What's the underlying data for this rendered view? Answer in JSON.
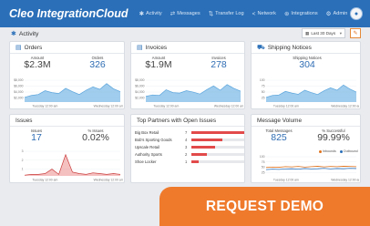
{
  "app": {
    "brand": "Cleo IntegrationCloud"
  },
  "nav": [
    {
      "label": "Activity",
      "icon": "activity-icon"
    },
    {
      "label": "Messages",
      "icon": "messages-icon"
    },
    {
      "label": "Transfer Log",
      "icon": "transfer-log-icon"
    },
    {
      "label": "Network",
      "icon": "network-icon"
    },
    {
      "label": "Integrations",
      "icon": "integrations-icon"
    },
    {
      "label": "Admin",
      "icon": "gear-icon"
    }
  ],
  "page": {
    "title": "Activity",
    "date_range": "Last 30 Days"
  },
  "orders": {
    "title": "Orders",
    "amount_label": "Amount",
    "amount": "$2.3M",
    "orders_label": "Orders",
    "orders": "326",
    "x_ticks": [
      "Tuesday 12:00 am",
      "Wednesday 12:00 am"
    ],
    "y_ticks": [
      "$8,000",
      "$6,000",
      "$4,000",
      "$2,000"
    ],
    "chart_data": {
      "type": "area",
      "x": [
        0,
        1,
        2,
        3,
        4,
        5,
        6,
        7,
        8,
        9,
        10,
        11,
        12,
        13,
        14
      ],
      "values": [
        1.0,
        1.4,
        1.6,
        2.4,
        2.0,
        1.8,
        2.9,
        2.2,
        1.6,
        2.5,
        3.2,
        2.7,
        3.9,
        2.8,
        2.2
      ],
      "ylim": [
        0,
        5
      ]
    }
  },
  "invoices": {
    "title": "Invoices",
    "amount_label": "Amount",
    "amount": "$1.9M",
    "invoices_label": "Invoices",
    "invoices": "278",
    "x_ticks": [
      "Tuesday 12:00 am",
      "Wednesday 12:00 am"
    ],
    "y_ticks": [
      "$8,000",
      "$6,000",
      "$4,000",
      "$2,000"
    ],
    "chart_data": {
      "type": "area",
      "x": [
        0,
        1,
        2,
        3,
        4,
        5,
        6,
        7,
        8,
        9,
        10,
        11,
        12,
        13,
        14
      ],
      "values": [
        1.2,
        1.5,
        1.4,
        2.6,
        2.0,
        1.9,
        2.4,
        2.1,
        1.7,
        2.6,
        3.4,
        2.5,
        3.7,
        2.9,
        2.3
      ],
      "ylim": [
        0,
        5
      ]
    }
  },
  "shipping": {
    "title": "Shipping Notices",
    "notices_label": "Shipping Notices",
    "notices": "304",
    "x_ticks": [
      "Tuesday 12:00 am",
      "Wednesday 12:00 am"
    ],
    "y_ticks": [
      "100",
      "75",
      "50",
      "25"
    ],
    "chart_data": {
      "type": "area",
      "x": [
        0,
        1,
        2,
        3,
        4,
        5,
        6,
        7,
        8,
        9,
        10,
        11,
        12,
        13,
        14
      ],
      "values": [
        20,
        28,
        30,
        45,
        38,
        33,
        50,
        40,
        32,
        48,
        60,
        50,
        72,
        55,
        42
      ],
      "ylim": [
        0,
        100
      ]
    }
  },
  "issues": {
    "title": "Issues",
    "issues_label": "Issues",
    "issues": "17",
    "pct_label": "% Issues",
    "pct": "0.02%",
    "x_ticks": [
      "Tuesday 12:00 am",
      "Wednesday 12:00 am"
    ],
    "y_ticks": [
      "3",
      "2",
      "1"
    ],
    "chart_data": {
      "type": "area",
      "x": [
        0,
        1,
        2,
        3,
        4,
        5,
        6,
        7,
        8,
        9,
        10,
        11,
        12,
        13,
        14
      ],
      "values": [
        0.1,
        0.2,
        0.2,
        0.3,
        0.9,
        0.2,
        2.8,
        0.5,
        0.3,
        0.2,
        0.4,
        0.3,
        0.2,
        0.3,
        0.2
      ],
      "ylim": [
        0,
        3.5
      ]
    }
  },
  "partners": {
    "title": "Top Partners with Open Issues",
    "rows": [
      {
        "name": "Big Box Retail",
        "count": "7",
        "fraction": 1.0
      },
      {
        "name": "Bob's Sporting Goods",
        "count": "4",
        "fraction": 0.57
      },
      {
        "name": "Upscale Retail",
        "count": "3",
        "fraction": 0.43
      },
      {
        "name": "Authority Sports",
        "count": "2",
        "fraction": 0.29
      },
      {
        "name": "Shoe Locker",
        "count": "1",
        "fraction": 0.14
      }
    ],
    "bar_color": "#e24a4a"
  },
  "volume": {
    "title": "Message Volume",
    "total_label": "Total Messages",
    "total": "825",
    "pct_label": "% Successful",
    "pct": "99.99%",
    "legend": [
      "Inbounds",
      "Outbound"
    ],
    "x_ticks": [
      "Tuesday 12:00 am",
      "Wednesday 12:00 am"
    ],
    "y_ticks": [
      "100",
      "75",
      "50",
      "25"
    ],
    "chart_data": {
      "type": "line",
      "x": [
        0,
        1,
        2,
        3,
        4,
        5,
        6,
        7,
        8,
        9,
        10,
        11,
        12,
        13,
        14
      ],
      "series": [
        {
          "name": "Inbounds",
          "color": "#e0731e",
          "values": [
            40,
            42,
            41,
            44,
            43,
            45,
            42,
            44,
            46,
            43,
            45,
            44,
            46,
            45,
            44
          ]
        },
        {
          "name": "Outbound",
          "color": "#2a6fb8",
          "values": [
            30,
            32,
            31,
            33,
            34,
            32,
            35,
            33,
            34,
            36,
            33,
            35,
            34,
            36,
            35
          ]
        }
      ],
      "ylim": [
        0,
        100
      ]
    }
  },
  "cta": {
    "label": "REQUEST DEMO"
  },
  "colors": {
    "accent": "#2a6fb8",
    "area": "#8fc3ea",
    "issues": "#e24a4a",
    "cta": "#ef7a2c"
  }
}
